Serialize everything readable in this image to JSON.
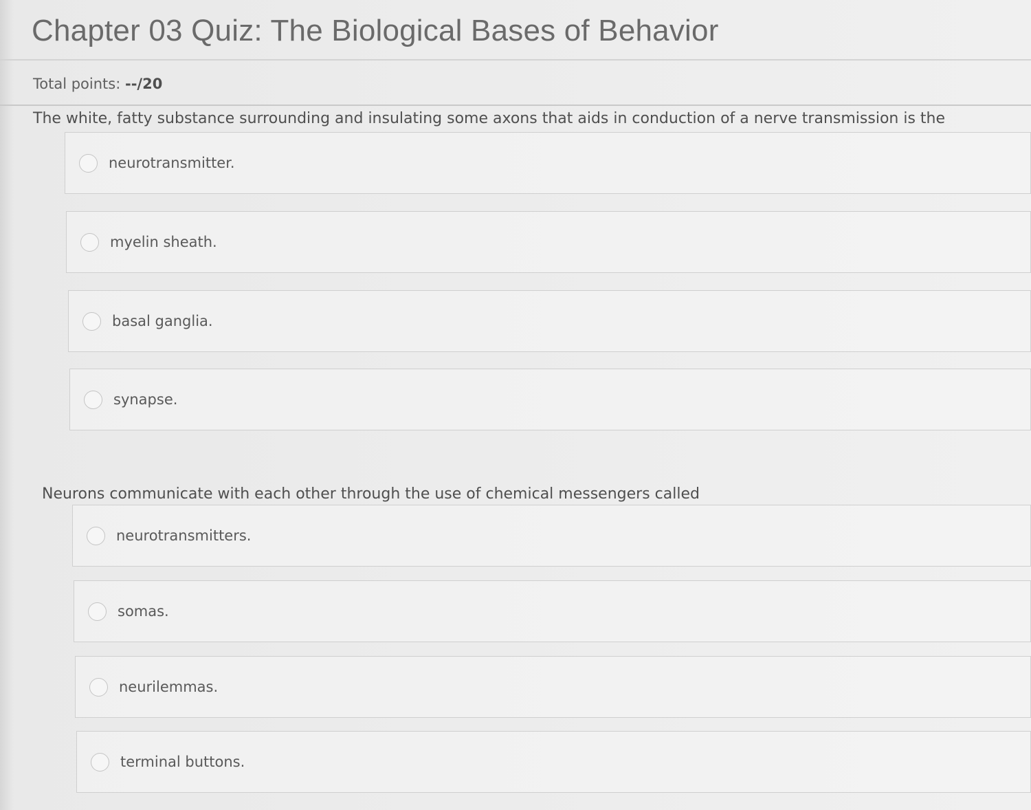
{
  "quiz": {
    "title": "Chapter 03 Quiz: The Biological Bases of Behavior",
    "total_points_label": "Total points:",
    "total_points_value": "--/20"
  },
  "questions": [
    {
      "text": "The white, fatty substance surrounding and insulating some axons that aids in conduction of a nerve transmission is the",
      "options": [
        "neurotransmitter.",
        "myelin sheath.",
        "basal ganglia.",
        "synapse."
      ]
    },
    {
      "text": "Neurons communicate with each other through the use of chemical messengers called",
      "options": [
        "neurotransmitters.",
        "somas.",
        "neurilemmas.",
        "terminal buttons."
      ]
    }
  ],
  "icons": {
    "radio": "radio-unselected-icon"
  }
}
